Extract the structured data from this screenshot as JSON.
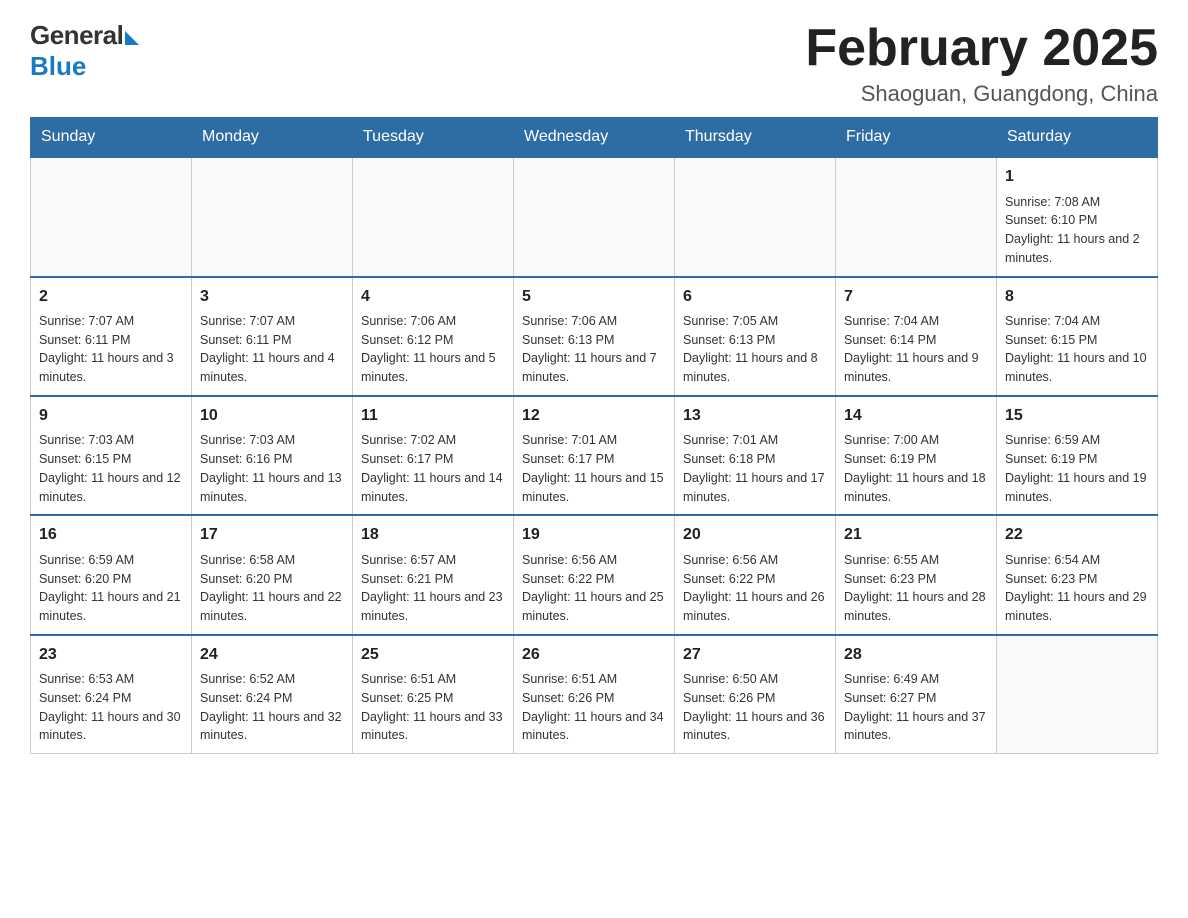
{
  "header": {
    "logo_general": "General",
    "logo_blue": "Blue",
    "title": "February 2025",
    "location": "Shaoguan, Guangdong, China"
  },
  "days_of_week": [
    "Sunday",
    "Monday",
    "Tuesday",
    "Wednesday",
    "Thursday",
    "Friday",
    "Saturday"
  ],
  "weeks": [
    [
      {
        "day": "",
        "info": ""
      },
      {
        "day": "",
        "info": ""
      },
      {
        "day": "",
        "info": ""
      },
      {
        "day": "",
        "info": ""
      },
      {
        "day": "",
        "info": ""
      },
      {
        "day": "",
        "info": ""
      },
      {
        "day": "1",
        "info": "Sunrise: 7:08 AM\nSunset: 6:10 PM\nDaylight: 11 hours and 2 minutes."
      }
    ],
    [
      {
        "day": "2",
        "info": "Sunrise: 7:07 AM\nSunset: 6:11 PM\nDaylight: 11 hours and 3 minutes."
      },
      {
        "day": "3",
        "info": "Sunrise: 7:07 AM\nSunset: 6:11 PM\nDaylight: 11 hours and 4 minutes."
      },
      {
        "day": "4",
        "info": "Sunrise: 7:06 AM\nSunset: 6:12 PM\nDaylight: 11 hours and 5 minutes."
      },
      {
        "day": "5",
        "info": "Sunrise: 7:06 AM\nSunset: 6:13 PM\nDaylight: 11 hours and 7 minutes."
      },
      {
        "day": "6",
        "info": "Sunrise: 7:05 AM\nSunset: 6:13 PM\nDaylight: 11 hours and 8 minutes."
      },
      {
        "day": "7",
        "info": "Sunrise: 7:04 AM\nSunset: 6:14 PM\nDaylight: 11 hours and 9 minutes."
      },
      {
        "day": "8",
        "info": "Sunrise: 7:04 AM\nSunset: 6:15 PM\nDaylight: 11 hours and 10 minutes."
      }
    ],
    [
      {
        "day": "9",
        "info": "Sunrise: 7:03 AM\nSunset: 6:15 PM\nDaylight: 11 hours and 12 minutes."
      },
      {
        "day": "10",
        "info": "Sunrise: 7:03 AM\nSunset: 6:16 PM\nDaylight: 11 hours and 13 minutes."
      },
      {
        "day": "11",
        "info": "Sunrise: 7:02 AM\nSunset: 6:17 PM\nDaylight: 11 hours and 14 minutes."
      },
      {
        "day": "12",
        "info": "Sunrise: 7:01 AM\nSunset: 6:17 PM\nDaylight: 11 hours and 15 minutes."
      },
      {
        "day": "13",
        "info": "Sunrise: 7:01 AM\nSunset: 6:18 PM\nDaylight: 11 hours and 17 minutes."
      },
      {
        "day": "14",
        "info": "Sunrise: 7:00 AM\nSunset: 6:19 PM\nDaylight: 11 hours and 18 minutes."
      },
      {
        "day": "15",
        "info": "Sunrise: 6:59 AM\nSunset: 6:19 PM\nDaylight: 11 hours and 19 minutes."
      }
    ],
    [
      {
        "day": "16",
        "info": "Sunrise: 6:59 AM\nSunset: 6:20 PM\nDaylight: 11 hours and 21 minutes."
      },
      {
        "day": "17",
        "info": "Sunrise: 6:58 AM\nSunset: 6:20 PM\nDaylight: 11 hours and 22 minutes."
      },
      {
        "day": "18",
        "info": "Sunrise: 6:57 AM\nSunset: 6:21 PM\nDaylight: 11 hours and 23 minutes."
      },
      {
        "day": "19",
        "info": "Sunrise: 6:56 AM\nSunset: 6:22 PM\nDaylight: 11 hours and 25 minutes."
      },
      {
        "day": "20",
        "info": "Sunrise: 6:56 AM\nSunset: 6:22 PM\nDaylight: 11 hours and 26 minutes."
      },
      {
        "day": "21",
        "info": "Sunrise: 6:55 AM\nSunset: 6:23 PM\nDaylight: 11 hours and 28 minutes."
      },
      {
        "day": "22",
        "info": "Sunrise: 6:54 AM\nSunset: 6:23 PM\nDaylight: 11 hours and 29 minutes."
      }
    ],
    [
      {
        "day": "23",
        "info": "Sunrise: 6:53 AM\nSunset: 6:24 PM\nDaylight: 11 hours and 30 minutes."
      },
      {
        "day": "24",
        "info": "Sunrise: 6:52 AM\nSunset: 6:24 PM\nDaylight: 11 hours and 32 minutes."
      },
      {
        "day": "25",
        "info": "Sunrise: 6:51 AM\nSunset: 6:25 PM\nDaylight: 11 hours and 33 minutes."
      },
      {
        "day": "26",
        "info": "Sunrise: 6:51 AM\nSunset: 6:26 PM\nDaylight: 11 hours and 34 minutes."
      },
      {
        "day": "27",
        "info": "Sunrise: 6:50 AM\nSunset: 6:26 PM\nDaylight: 11 hours and 36 minutes."
      },
      {
        "day": "28",
        "info": "Sunrise: 6:49 AM\nSunset: 6:27 PM\nDaylight: 11 hours and 37 minutes."
      },
      {
        "day": "",
        "info": ""
      }
    ]
  ]
}
